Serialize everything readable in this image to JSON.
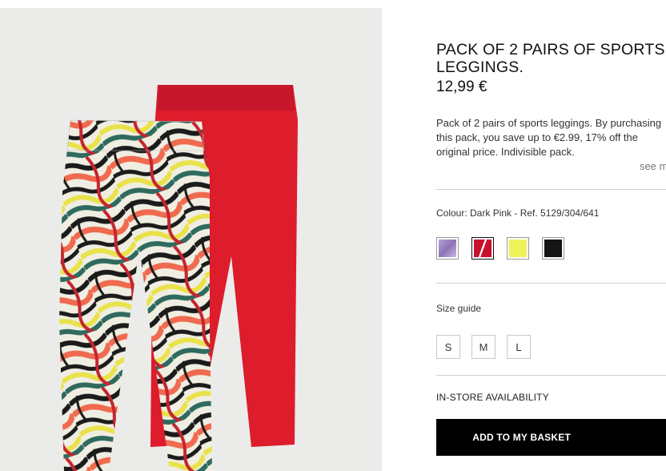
{
  "product": {
    "title": "PACK OF 2 PAIRS OF SPORTS LEGGINGS.",
    "price": "12,99 €",
    "description_lines": [
      "Pack of 2 pairs of sports leggings. By purchasing",
      "this pack, you save up to €2.99, 17% off the",
      "original price. Indivisible pack."
    ],
    "see_more": "see more",
    "colour_line": "Colour: Dark Pink - Ref. 5129/304/641",
    "swatches": [
      {
        "name": "lilac",
        "color": "#a98fc7"
      },
      {
        "name": "red",
        "color": "#c8102e"
      },
      {
        "name": "yellow",
        "color": "#eef25a"
      },
      {
        "name": "black",
        "color": "#151515"
      }
    ],
    "size_guide": "Size guide",
    "sizes": [
      "S",
      "M",
      "L"
    ],
    "store_availability": "IN-STORE AVAILABILITY",
    "add_to_basket": "ADD TO MY BASKET"
  },
  "image": {
    "background": "#ebebea",
    "solid_colour": "#dd1c2c",
    "print_colours": [
      "#1b1b1b",
      "#f0eee2",
      "#ef6a4f",
      "#e9e24a",
      "#2f6a5e",
      "#c4252f"
    ]
  }
}
